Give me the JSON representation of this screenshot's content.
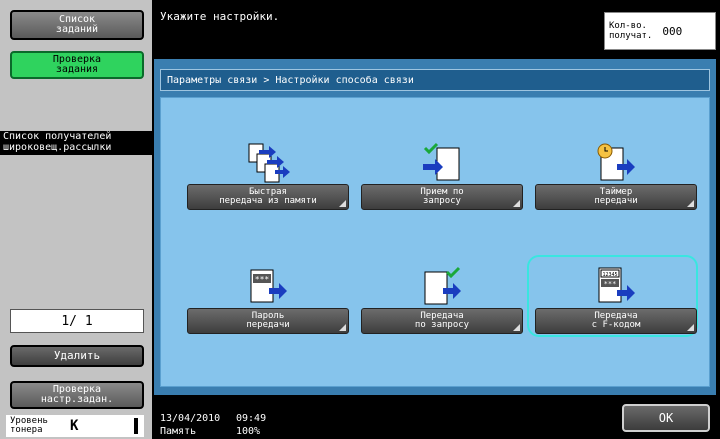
{
  "sidebar": {
    "job_list": "Список\nзаданий",
    "check_job": "Проверка\nзадания",
    "broadcast_list": "Список получателей\nшироковещ.рассылки",
    "page_indicator": "1/ 1",
    "delete": "Удалить",
    "check_job_settings": "Проверка\nнастр.задан.",
    "toner_label": "Уровень\nтонера",
    "toner_code": "K"
  },
  "header": {
    "message": "Укажите настройки.",
    "copies_label": "Кол-во.\nполучат.",
    "copies_value": "000"
  },
  "panel": {
    "breadcrumb": "Параметры связи > Настройки способа связи",
    "functions": [
      {
        "label": "Быстрая\nпередача из памяти",
        "icon": "quick-memory-tx-icon"
      },
      {
        "label": "Прием по\nзапросу",
        "icon": "polling-rx-icon"
      },
      {
        "label": "Таймер\nпередачи",
        "icon": "timer-tx-icon"
      },
      {
        "label": "Пароль\nпередачи",
        "icon": "password-tx-icon"
      },
      {
        "label": "Передача\nпо запросу",
        "icon": "polling-tx-icon"
      },
      {
        "label": "Передача\nс F-кодом",
        "icon": "fcode-tx-icon"
      }
    ],
    "fcode_icon_text": "12345",
    "password_icon_text": "***"
  },
  "footer": {
    "date": "13/04/2010",
    "time": "09:49",
    "memory_label": "Память",
    "memory_value": "100%",
    "ok": "OK"
  },
  "colors": {
    "panel_bg": "#3a7eb0",
    "function_area_bg": "#86c4ec",
    "highlight": "#39e6e0",
    "active_green": "#2fd35e"
  }
}
